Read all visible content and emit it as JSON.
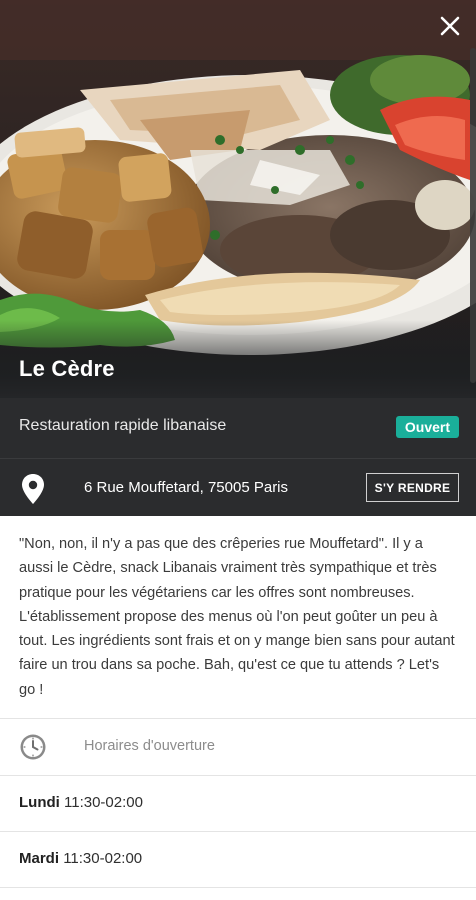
{
  "restaurant": {
    "name": "Le Cèdre",
    "category": "Restauration rapide libanaise",
    "status": "Ouvert",
    "address": "6 Rue Mouffetard, 75005 Paris"
  },
  "actions": {
    "directions_label": "S'Y RENDRE"
  },
  "description": "\"Non, non, il n'y a pas que des crêperies rue Mouffetard\". Il y a aussi le Cèdre, snack Libanais vraiment très sympathique et très pratique pour les végétariens car les offres sont nombreuses. L'établissement propose des menus où l'on peut goûter un peu à tout. Les ingrédients sont frais et on y mange bien sans pour autant faire un trou dans sa poche. Bah, qu'est ce que tu attends ? Let's go !",
  "hours": {
    "title": "Horaires d'ouverture",
    "days": [
      {
        "day": "Lundi",
        "time": "11:30-02:00"
      },
      {
        "day": "Mardi",
        "time": "11:30-02:00"
      }
    ]
  },
  "colors": {
    "status_badge": "#1aaf9a",
    "band": "#2b2c2e"
  },
  "icons": {
    "close": "close-icon",
    "location": "location-pin-icon",
    "clock": "clock-icon"
  }
}
